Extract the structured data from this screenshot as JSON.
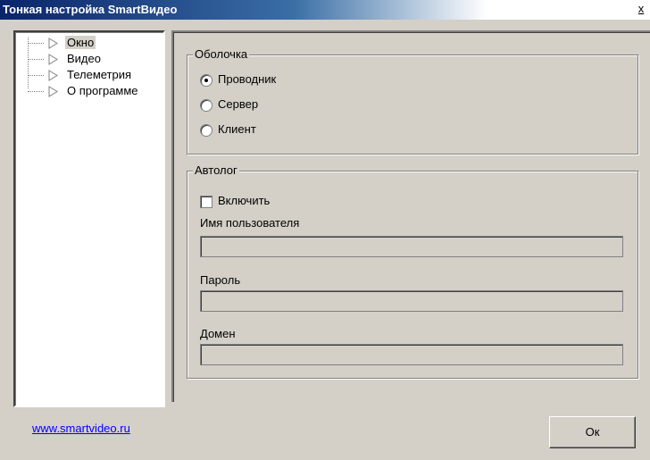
{
  "window": {
    "title": "Тонкая настройка SmartВидео",
    "close_label": "x"
  },
  "tree": {
    "items": [
      {
        "label": "Окно",
        "selected": true
      },
      {
        "label": "Видео",
        "selected": false
      },
      {
        "label": "Телеметрия",
        "selected": false
      },
      {
        "label": "О программе",
        "selected": false
      }
    ]
  },
  "shell_group": {
    "title": "Оболочка",
    "options": [
      {
        "label": "Проводник",
        "checked": true
      },
      {
        "label": "Сервер",
        "checked": false
      },
      {
        "label": "Клиент",
        "checked": false
      }
    ]
  },
  "autolog_group": {
    "title": "Автолог",
    "enable_label": "Включить",
    "enable_checked": false,
    "username_label": "Имя пользователя",
    "username_value": "",
    "password_label": "Пароль",
    "password_value": "",
    "domain_label": "Домен",
    "domain_value": ""
  },
  "footer": {
    "link_text": "www.smartvideo.ru",
    "ok_label": "Ок"
  },
  "colors": {
    "title_bar": "#0a246a",
    "face": "#d4d0c8",
    "link": "#0000ff"
  }
}
